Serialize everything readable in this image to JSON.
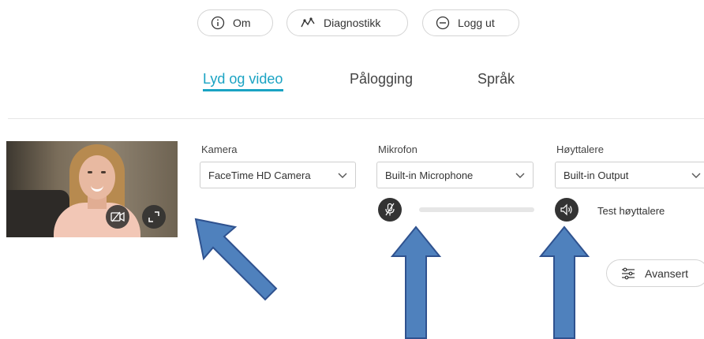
{
  "header": {
    "about_label": "Om",
    "diagnostics_label": "Diagnostikk",
    "logout_label": "Logg ut"
  },
  "tabs": [
    {
      "label": "Lyd og video",
      "active": true
    },
    {
      "label": "Pålogging",
      "active": false
    },
    {
      "label": "Språk",
      "active": false
    }
  ],
  "camera": {
    "label": "Kamera",
    "selected": "FaceTime HD Camera"
  },
  "microphone": {
    "label": "Mikrofon",
    "selected": "Built-in Microphone",
    "level": 0
  },
  "speakers": {
    "label": "Høyttalere",
    "selected": "Built-in Output",
    "test_label": "Test høyttalere"
  },
  "advanced_label": "Avansert",
  "colors": {
    "accent": "#1aa3c3",
    "arrow_fill": "#4f81bd",
    "arrow_stroke": "#2f528f"
  },
  "icons": [
    "info-icon",
    "diagnostics-icon",
    "logout-icon",
    "camera-off-icon",
    "fullscreen-icon",
    "mic-muted-icon",
    "speaker-icon",
    "sliders-icon",
    "chevron-down-icon"
  ]
}
